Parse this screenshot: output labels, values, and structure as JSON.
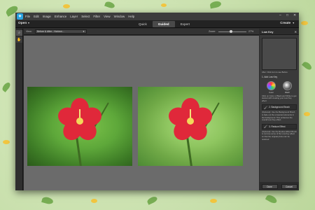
{
  "menubar": {
    "items": [
      "File",
      "Edit",
      "Image",
      "Enhance",
      "Layer",
      "Select",
      "Filter",
      "View",
      "Window",
      "Help"
    ],
    "window_controls": [
      "minimize-icon",
      "maximize-icon",
      "close-icon"
    ]
  },
  "modebar": {
    "open_label": "Open",
    "tabs": [
      {
        "label": "Quick",
        "active": false
      },
      {
        "label": "Guided",
        "active": true
      },
      {
        "label": "Expert",
        "active": false
      }
    ],
    "create_label": "Create"
  },
  "options": {
    "view_label": "View:",
    "view_value": "Before & After - Horizon...",
    "zoom_label": "Zoom:",
    "zoom_value": "27%"
  },
  "panel": {
    "title": "Low Key",
    "hint": "After: Click icon to see Before",
    "step1": "1. Add Low Key",
    "color_label": "Color",
    "bw_label": "B&W",
    "step1_hint": "Click on Color or Black and White to get started with creating your Low Key effect",
    "step2": "2. Background Brush",
    "step2_hint": "(Optional): Use the Background Brush to fade out the unwanted elements in the background. This enhances the overall Low Key effect.",
    "step3": "3. Reduce Effect",
    "step3_hint": "(Optional): Use the Reduce Effect Brush to remove some of the Low Key effect so that the original photo can be restored",
    "done_label": "Done",
    "cancel_label": "Cancel"
  },
  "accent_color": "#2aa2e0"
}
